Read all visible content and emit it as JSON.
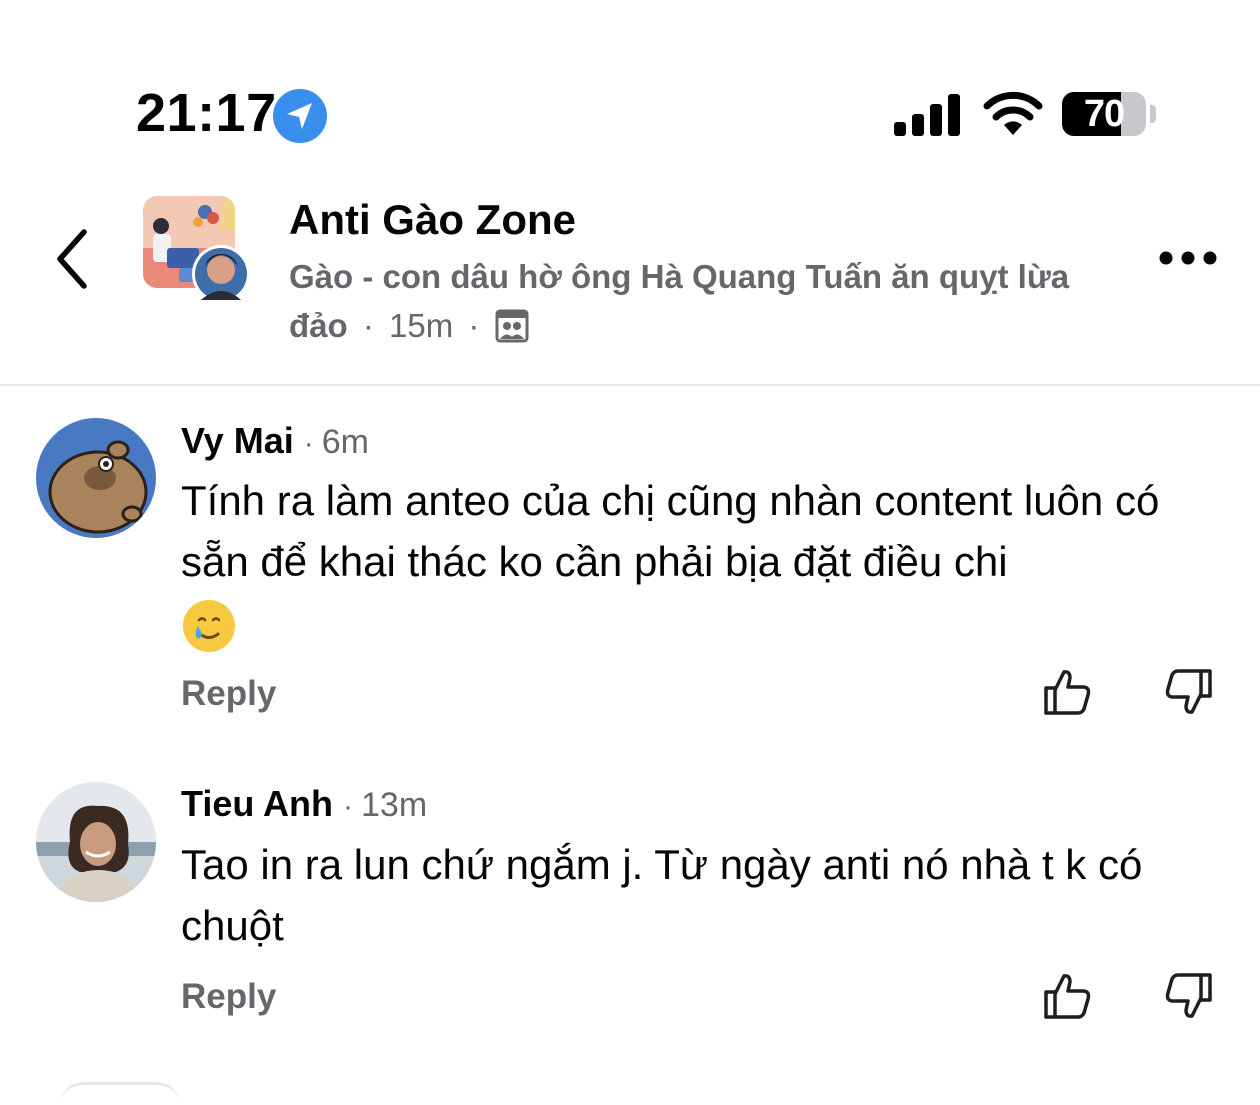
{
  "status_bar": {
    "time": "21:17",
    "battery_percent": "70",
    "battery_level": 0.7
  },
  "header": {
    "group_name": "Anti Gào Zone",
    "post_title": "Gào - con dâu hờ ông Hà Quang Tuấn ăn quỵt lừa đảo",
    "separator": "·",
    "time_ago": "15m",
    "privacy_icon": "group-members-icon"
  },
  "comments": [
    {
      "author": "Vy Mai",
      "time": "6m",
      "text": "Tính ra làm anteo của chị cũng nhàn content luôn có sẵn để khai thác ko cần phải bịa đặt điều chi",
      "emoji": "smiling-face-with-tear-icon",
      "reply_label": "Reply"
    },
    {
      "author": "Tieu Anh",
      "time": "13m",
      "text": "Tao in ra lun chứ ngắm j. Từ ngày anti nó nhà t k có chuột",
      "reply_label": "Reply"
    }
  ],
  "colors": {
    "accent_blue": "#3a8eed",
    "secondary_text": "#65676b",
    "primary_text": "#050505"
  }
}
